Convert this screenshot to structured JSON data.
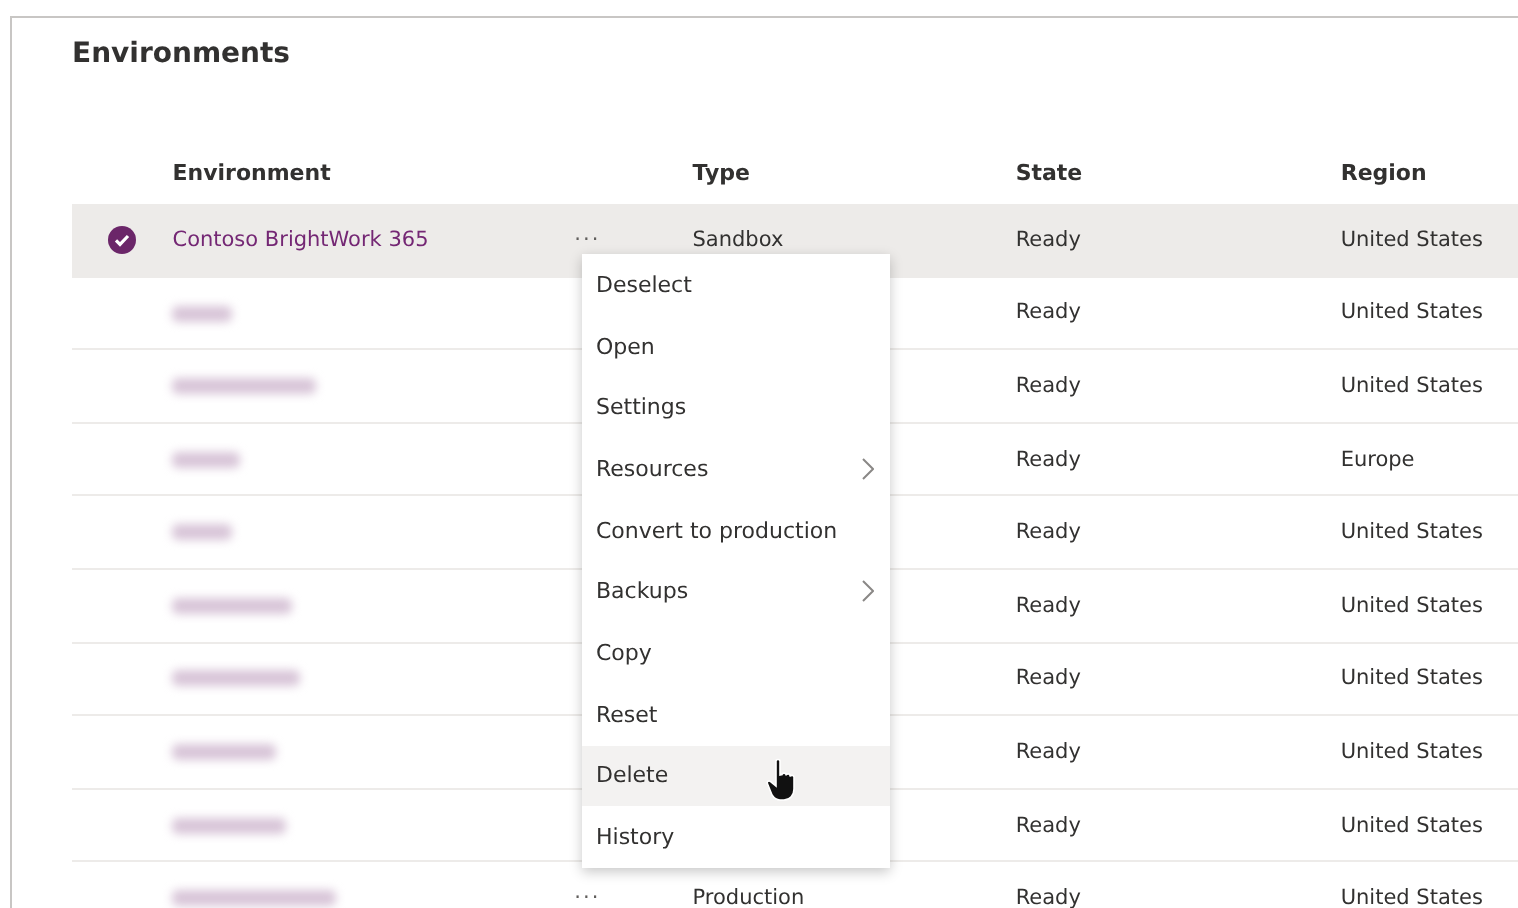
{
  "title": "Environments",
  "columns": [
    "Environment",
    "Type",
    "State",
    "Region"
  ],
  "rows": [
    {
      "selected": true,
      "name": "Contoso BrightWork 365",
      "more": "···",
      "type": "Sandbox",
      "state": "Ready",
      "region": "United States"
    },
    {
      "selected": false,
      "blurred": true,
      "state": "Ready",
      "region": "United States"
    },
    {
      "selected": false,
      "blurred": true,
      "state": "Ready",
      "region": "United States"
    },
    {
      "selected": false,
      "blurred": true,
      "state": "Ready",
      "region": "Europe"
    },
    {
      "selected": false,
      "blurred": true,
      "state": "Ready",
      "region": "United States"
    },
    {
      "selected": false,
      "blurred": true,
      "state": "Ready",
      "region": "United States"
    },
    {
      "selected": false,
      "blurred": true,
      "state": "Ready",
      "region": "United States"
    },
    {
      "selected": false,
      "blurred": true,
      "state": "Ready",
      "region": "United States"
    },
    {
      "selected": false,
      "blurred": true,
      "state": "Ready",
      "region": "United States"
    },
    {
      "selected": false,
      "blurred": true,
      "more": "···",
      "type": "Production",
      "state": "Ready",
      "region": "United States"
    }
  ],
  "menu": [
    {
      "label": "Deselect",
      "submenu": false,
      "hovered": false
    },
    {
      "label": "Open",
      "submenu": false,
      "hovered": false
    },
    {
      "label": "Settings",
      "submenu": false,
      "hovered": false
    },
    {
      "label": "Resources",
      "submenu": true,
      "hovered": false
    },
    {
      "label": "Convert to production",
      "submenu": false,
      "hovered": false
    },
    {
      "label": "Backups",
      "submenu": true,
      "hovered": false
    },
    {
      "label": "Copy",
      "submenu": false,
      "hovered": false
    },
    {
      "label": "Reset",
      "submenu": false,
      "hovered": false
    },
    {
      "label": "Delete",
      "submenu": false,
      "hovered": true
    },
    {
      "label": "History",
      "submenu": false,
      "hovered": false
    }
  ]
}
